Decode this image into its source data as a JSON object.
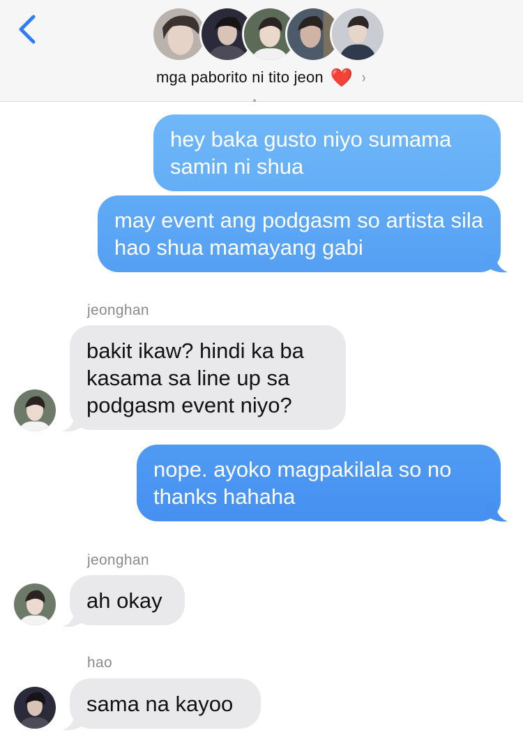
{
  "header": {
    "group_name": "mga paborito ni tito jeon",
    "heart": "❤️",
    "chevron": "›",
    "avatars": [
      "member-1",
      "member-2",
      "member-3",
      "member-4",
      "member-5"
    ]
  },
  "messages": [
    {
      "from": "me",
      "text": "hey baka gusto niyo sumama samin ni shua"
    },
    {
      "from": "me",
      "text": "may event ang podgasm so artista sila hao shua mamayang gabi"
    },
    {
      "from": "jeonghan",
      "sender": "jeonghan",
      "text": "bakit ikaw? hindi ka ba kasama sa line up sa podgasm event niyo?"
    },
    {
      "from": "me",
      "text": "nope. ayoko magpakilala so no thanks hahaha"
    },
    {
      "from": "jeonghan",
      "sender": "jeonghan",
      "text": "ah okay"
    },
    {
      "from": "hao",
      "sender": "hao",
      "text": "sama na kayoo"
    }
  ],
  "colors": {
    "outgoing_top": "#6ab4f8",
    "outgoing_bottom": "#3b87ee",
    "incoming": "#e9e9eb",
    "accent": "#2f7cf6"
  }
}
